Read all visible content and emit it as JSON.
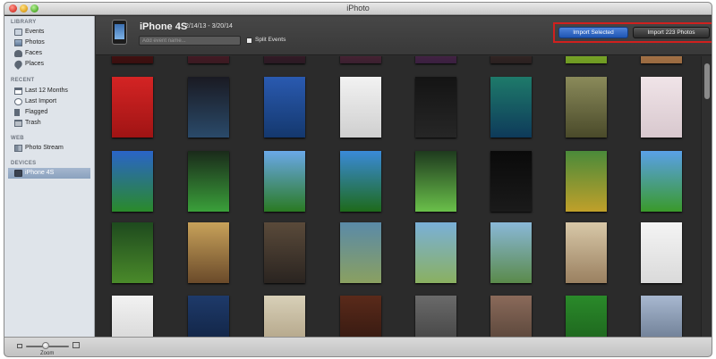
{
  "window": {
    "title": "iPhoto"
  },
  "sidebar": {
    "sections": [
      {
        "heading": "LIBRARY",
        "items": [
          {
            "label": "Events",
            "icon": "events-icon"
          },
          {
            "label": "Photos",
            "icon": "photos-icon"
          },
          {
            "label": "Faces",
            "icon": "faces-icon"
          },
          {
            "label": "Places",
            "icon": "places-icon"
          }
        ]
      },
      {
        "heading": "RECENT",
        "items": [
          {
            "label": "Last 12 Months",
            "icon": "calendar-icon"
          },
          {
            "label": "Last Import",
            "icon": "clock-icon"
          },
          {
            "label": "Flagged",
            "icon": "flag-icon"
          },
          {
            "label": "Trash",
            "icon": "trash-icon"
          }
        ]
      },
      {
        "heading": "WEB",
        "items": [
          {
            "label": "Photo Stream",
            "icon": "photo-stream-icon"
          }
        ]
      },
      {
        "heading": "DEVICES",
        "items": [
          {
            "label": "iPhone 4S",
            "icon": "iphone-icon",
            "selected": true
          }
        ]
      }
    ]
  },
  "header": {
    "device_name": "iPhone 4S",
    "date_range": "2/14/13 - 3/20/14",
    "event_placeholder": "Add event name...",
    "split_events_label": "Split Events",
    "split_events_checked": false,
    "import_selected_label": "Import Selected",
    "import_all_label": "Import 223 Photos"
  },
  "bottom": {
    "zoom_label": "Zoom",
    "zoom_level": 0.45
  },
  "thumbnails": [
    {
      "row": 0,
      "col": 0,
      "colors": [
        "#6b1a1a",
        "#3a0f0f"
      ]
    },
    {
      "row": 0,
      "col": 1,
      "colors": [
        "#8a1f2f",
        "#3a1a22"
      ]
    },
    {
      "row": 0,
      "col": 2,
      "colors": [
        "#7a2030",
        "#2a1a24"
      ]
    },
    {
      "row": 0,
      "col": 3,
      "colors": [
        "#9a3040",
        "#3a2030"
      ]
    },
    {
      "row": 0,
      "col": 4,
      "colors": [
        "#7a3050",
        "#3a2040"
      ]
    },
    {
      "row": 0,
      "col": 5,
      "colors": [
        "#6a4a3a",
        "#2a2020"
      ]
    },
    {
      "row": 0,
      "col": 6,
      "colors": [
        "#b8d84a",
        "#6e9a22"
      ]
    },
    {
      "row": 0,
      "col": 7,
      "colors": [
        "#d8a070",
        "#9a6a40"
      ]
    },
    {
      "row": 1,
      "col": 0,
      "colors": [
        "#d42424",
        "#a01414"
      ]
    },
    {
      "row": 1,
      "col": 1,
      "colors": [
        "#1a1a22",
        "#2a4a6a"
      ]
    },
    {
      "row": 1,
      "col": 2,
      "colors": [
        "#2a5ab0",
        "#14386e"
      ]
    },
    {
      "row": 1,
      "col": 3,
      "colors": [
        "#f2f2f2",
        "#cfcfcf"
      ]
    },
    {
      "row": 1,
      "col": 4,
      "colors": [
        "#141414",
        "#262626"
      ]
    },
    {
      "row": 1,
      "col": 5,
      "colors": [
        "#1e7a6a",
        "#0e3a5a"
      ]
    },
    {
      "row": 1,
      "col": 6,
      "colors": [
        "#8a8a5a",
        "#4a4a2a"
      ]
    },
    {
      "row": 1,
      "col": 7,
      "colors": [
        "#f0e4e8",
        "#d8c8ce"
      ]
    },
    {
      "row": 2,
      "col": 0,
      "colors": [
        "#2a64c8",
        "#2a8a2a"
      ]
    },
    {
      "row": 2,
      "col": 1,
      "colors": [
        "#1a2a1a",
        "#3aa03a"
      ]
    },
    {
      "row": 2,
      "col": 2,
      "colors": [
        "#6aa8e8",
        "#2a7a22"
      ]
    },
    {
      "row": 2,
      "col": 3,
      "colors": [
        "#3a8ad8",
        "#1e6a1a"
      ]
    },
    {
      "row": 2,
      "col": 4,
      "colors": [
        "#1e3a1e",
        "#6ac04a"
      ]
    },
    {
      "row": 2,
      "col": 5,
      "colors": [
        "#0a0a0a",
        "#1a1a1a"
      ]
    },
    {
      "row": 2,
      "col": 6,
      "colors": [
        "#4a8a3a",
        "#c0a02a"
      ]
    },
    {
      "row": 2,
      "col": 7,
      "colors": [
        "#5aa0e8",
        "#3a9a2a"
      ]
    },
    {
      "row": 3,
      "col": 0,
      "colors": [
        "#1e4a1e",
        "#4a8a2a"
      ]
    },
    {
      "row": 3,
      "col": 1,
      "colors": [
        "#c8a25a",
        "#6a4a2a"
      ]
    },
    {
      "row": 3,
      "col": 2,
      "colors": [
        "#5a4a3a",
        "#2a2420"
      ]
    },
    {
      "row": 3,
      "col": 3,
      "colors": [
        "#5a8aa8",
        "#8aa060"
      ]
    },
    {
      "row": 3,
      "col": 4,
      "colors": [
        "#7ab0d8",
        "#8ab060"
      ]
    },
    {
      "row": 3,
      "col": 5,
      "colors": [
        "#8ab8d8",
        "#5a8a4a"
      ]
    },
    {
      "row": 3,
      "col": 6,
      "colors": [
        "#d8c8a8",
        "#9a8060"
      ]
    },
    {
      "row": 3,
      "col": 7,
      "colors": [
        "#f4f4f4",
        "#dadada"
      ]
    },
    {
      "row": 4,
      "col": 0,
      "colors": [
        "#f2f2f2",
        "#d0d0d0"
      ]
    },
    {
      "row": 4,
      "col": 1,
      "colors": [
        "#1e3a6a",
        "#0e1e3a"
      ]
    },
    {
      "row": 4,
      "col": 2,
      "colors": [
        "#d8d0b8",
        "#a8987a"
      ]
    },
    {
      "row": 4,
      "col": 3,
      "colors": [
        "#5a2a1a",
        "#2a140e"
      ]
    },
    {
      "row": 4,
      "col": 4,
      "colors": [
        "#6a6a6a",
        "#3a3a3a"
      ]
    },
    {
      "row": 4,
      "col": 5,
      "colors": [
        "#8a6a5a",
        "#4a3a30"
      ]
    },
    {
      "row": 4,
      "col": 6,
      "colors": [
        "#2a8a2a",
        "#1a5a1a"
      ]
    },
    {
      "row": 4,
      "col": 7,
      "colors": [
        "#a8b8d0",
        "#5a6a80"
      ]
    }
  ]
}
